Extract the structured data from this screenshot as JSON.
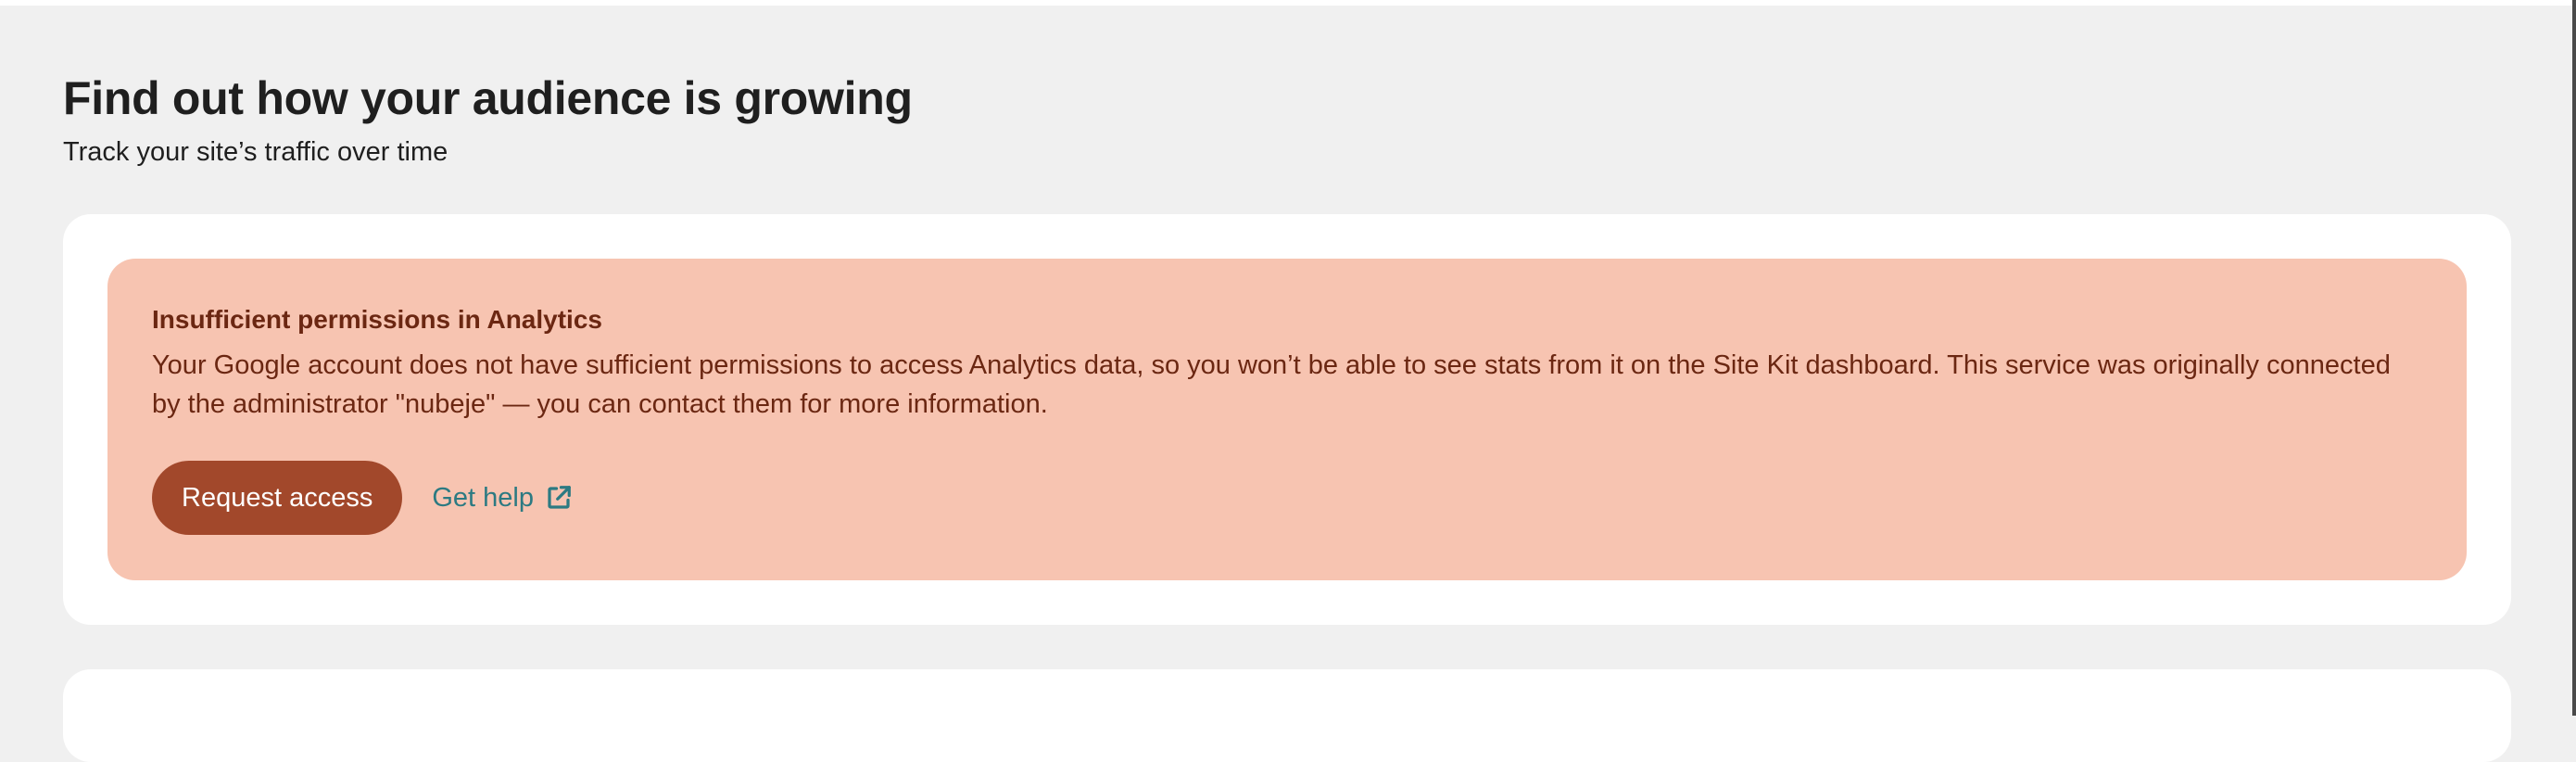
{
  "header": {
    "title": "Find out how your audience is growing",
    "subtitle": "Track your site’s traffic over time"
  },
  "notice": {
    "title": "Insufficient permissions in Analytics",
    "body": "Your Google account does not have sufficient permissions to access Analytics data, so you won’t be able to see stats from it on the Site Kit dashboard. This service was originally connected by the administrator \"nubeje\" — you can contact them for more information.",
    "primary_label": "Request access",
    "link_label": "Get help",
    "link_icon": "external-link-icon"
  },
  "colors": {
    "page_bg": "#f0f0f0",
    "notice_bg": "#f7c4b1",
    "notice_text": "#6b2712",
    "button_bg": "#a2482b",
    "link": "#2c7a82"
  }
}
